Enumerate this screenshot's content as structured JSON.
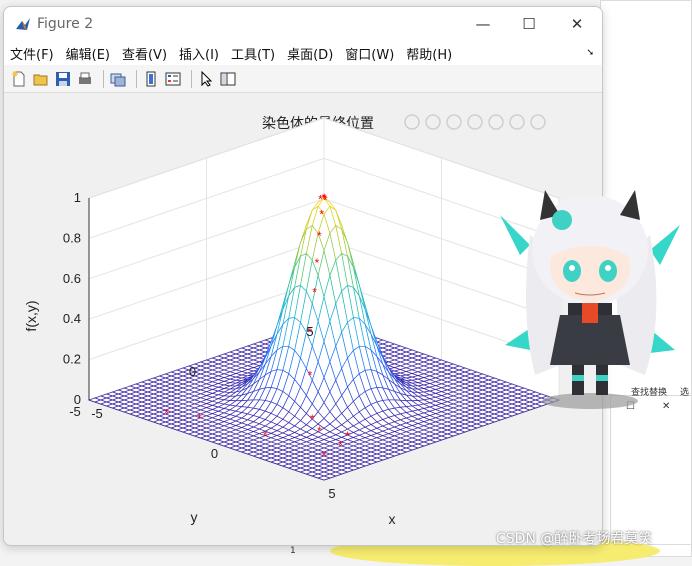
{
  "window": {
    "title": "Figure 2",
    "minimize": "—",
    "maximize": "☐",
    "close": "✕"
  },
  "menu": [
    {
      "label": "文件(F)"
    },
    {
      "label": "编辑(E)"
    },
    {
      "label": "查看(V)"
    },
    {
      "label": "插入(I)"
    },
    {
      "label": "工具(T)"
    },
    {
      "label": "桌面(D)"
    },
    {
      "label": "窗口(W)"
    },
    {
      "label": "帮助(H)"
    }
  ],
  "toolbar": [
    "new-icon",
    "open-icon",
    "save-icon",
    "print-icon",
    "link-icon",
    "colorbar-icon",
    "legend-icon",
    "pointer-icon",
    "property-editor-icon"
  ],
  "axes_toolbar": [
    "brush-icon",
    "datatip-icon",
    "rotate-icon",
    "pan-icon",
    "zoom-in-icon",
    "zoom-out-icon",
    "home-icon"
  ],
  "chart_data": {
    "type": "surface",
    "title": "染色体的最终位置",
    "xlabel": "x",
    "ylabel": "y",
    "zlabel": "f(x,y)",
    "xlim": [
      -5,
      5
    ],
    "ylim": [
      -5,
      5
    ],
    "zlim": [
      0,
      1
    ],
    "xticks": [
      "-5",
      "0",
      "5"
    ],
    "yticks": [
      "-5",
      "0",
      "5"
    ],
    "zticks": [
      "0",
      "0.2",
      "0.4",
      "0.6",
      "0.8",
      "1"
    ],
    "function": "exp(-(x^2+y^2)/2)",
    "grid": true,
    "markers": {
      "symbol": "*",
      "color": "#ff0000"
    }
  },
  "background": {
    "snippet_left": "查找替换",
    "snippet_right": "选",
    "small_tick": "1"
  },
  "watermark": "CSDN @醉卧考场君莫笑"
}
